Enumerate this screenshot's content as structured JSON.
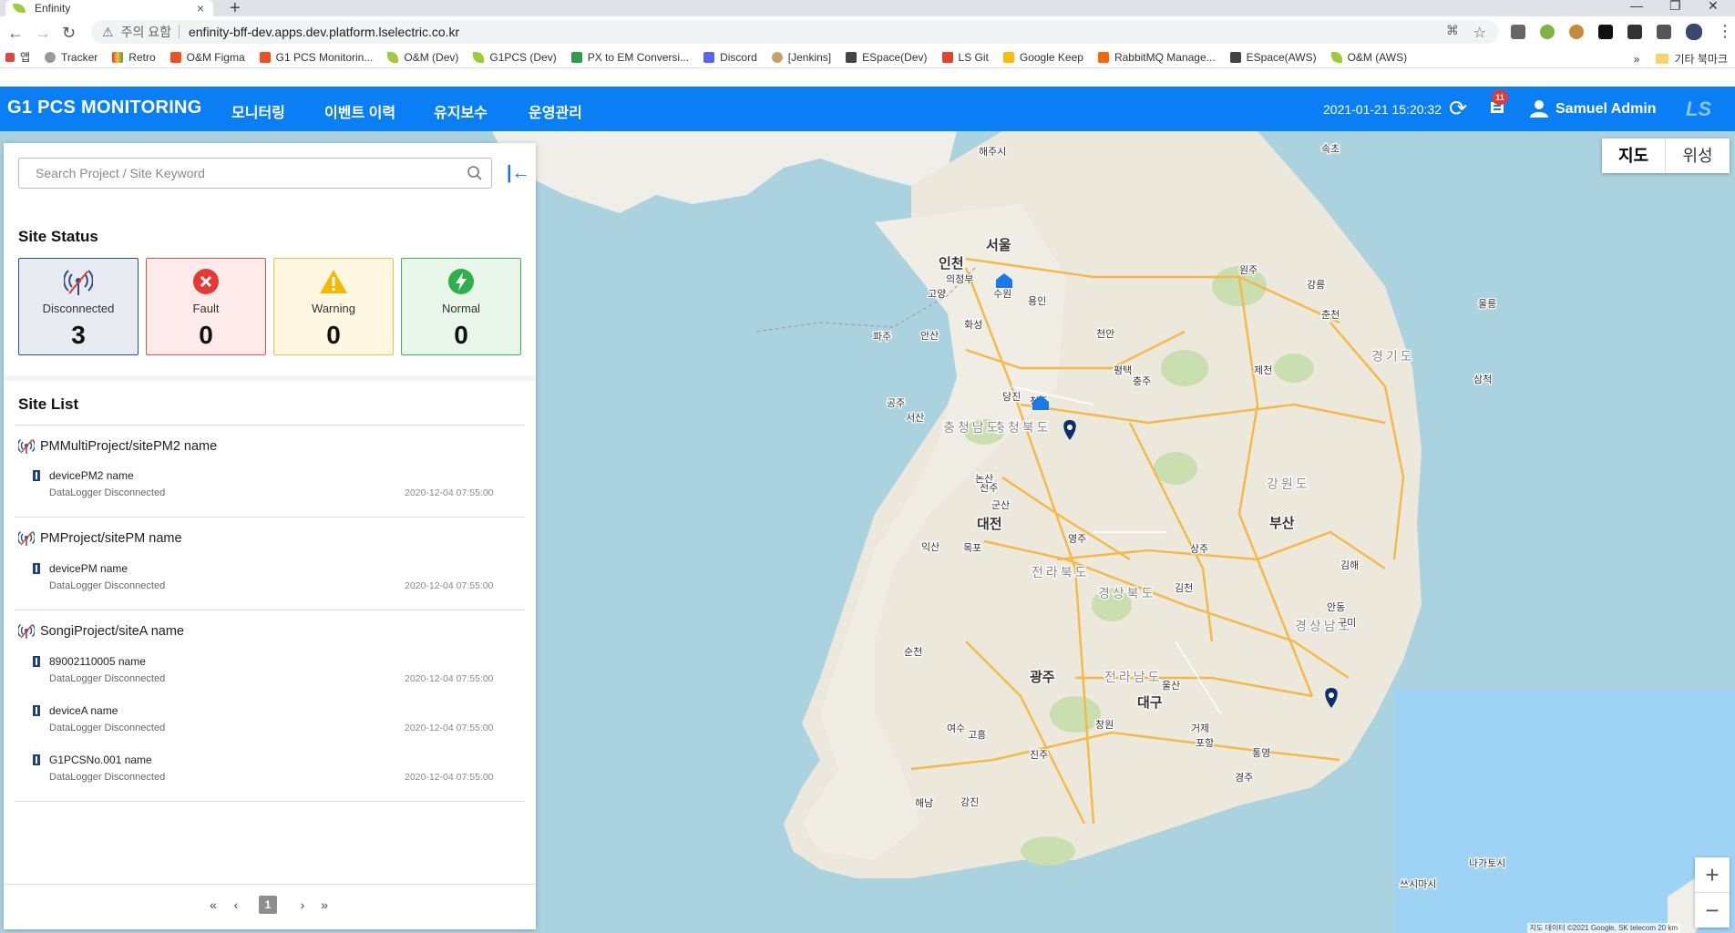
{
  "browser": {
    "tab_title": "Enfinity",
    "security_label": "주의 요함",
    "url": "enfinity-bff-dev.apps.dev.platform.lselectric.co.kr",
    "bookmarks": [
      "앱",
      "Tracker",
      "Retro",
      "O&M Figma",
      "G1 PCS Monitorin...",
      "O&M (Dev)",
      "G1PCS (Dev)",
      "PX to EM Conversi...",
      "Discord",
      "[Jenkins]",
      "ESpace(Dev)",
      "LS Git",
      "Google Keep",
      "RabbitMQ Manage...",
      "ESpace(AWS)",
      "O&M (AWS)"
    ],
    "other_bookmarks": "기타 북마크"
  },
  "header": {
    "brand": "G1 PCS MONITORING",
    "menu": [
      "모니터링",
      "이벤트 이력",
      "유지보수",
      "운영관리"
    ],
    "datetime": "2021-01-21 15:20:32",
    "notification_count": "11",
    "user": "Samuel Admin",
    "logo": "LS"
  },
  "sidebar": {
    "search_placeholder": "Search Project / Site Keyword",
    "status_title": "Site Status",
    "status": [
      {
        "label": "Disconnected",
        "count": "3",
        "color": "#2a5080"
      },
      {
        "label": "Fault",
        "count": "0",
        "color": "#e53935"
      },
      {
        "label": "Warning",
        "count": "0",
        "color": "#f5b800"
      },
      {
        "label": "Normal",
        "count": "0",
        "color": "#2fb04a"
      }
    ],
    "list_title": "Site List",
    "sites": [
      {
        "name": "PMMultiProject/sitePM2 name",
        "devices": [
          {
            "name": "devicePM2 name",
            "status": "DataLogger Disconnected",
            "time": "2020-12-04 07:55:00"
          }
        ]
      },
      {
        "name": "PMProject/sitePM name",
        "devices": [
          {
            "name": "devicePM name",
            "status": "DataLogger Disconnected",
            "time": "2020-12-04 07:55:00"
          }
        ]
      },
      {
        "name": "SongiProject/siteA name",
        "devices": [
          {
            "name": "89002110005 name",
            "status": "DataLogger Disconnected",
            "time": "2020-12-04 07:55:00"
          },
          {
            "name": "deviceA name",
            "status": "DataLogger Disconnected",
            "time": "2020-12-04 07:55:00"
          },
          {
            "name": "G1PCSNo.001 name",
            "status": "DataLogger Disconnected",
            "time": "2020-12-04 07:55:00"
          }
        ]
      }
    ],
    "pagination": {
      "current": "1"
    }
  },
  "map": {
    "toggle": [
      "지도",
      "위성"
    ],
    "labels": [
      "서울",
      "인천",
      "수원",
      "용인",
      "화성",
      "청주",
      "충청북도",
      "충청남도",
      "대전",
      "전주",
      "전라북도",
      "광주",
      "전라남도",
      "대구",
      "경상북도",
      "부산",
      "김해",
      "경상남도",
      "울산",
      "포항",
      "안동",
      "강원도",
      "춘천",
      "원주",
      "강릉",
      "경기도",
      "천안",
      "당진",
      "서산",
      "공주",
      "논산",
      "군산",
      "익산",
      "목포",
      "순천",
      "여수",
      "진주",
      "창원",
      "거제",
      "통영",
      "경주",
      "구미",
      "김천",
      "상주",
      "영주",
      "제천",
      "충주",
      "평택",
      "안산",
      "파주",
      "고양",
      "의정부",
      "해주시",
      "속초",
      "삼척",
      "울릉",
      "고흥",
      "해남",
      "강진",
      "나가토시",
      "쓰시마시"
    ],
    "attribution": "지도 데이터 ©2021 Google, SK telecom  20 km"
  }
}
